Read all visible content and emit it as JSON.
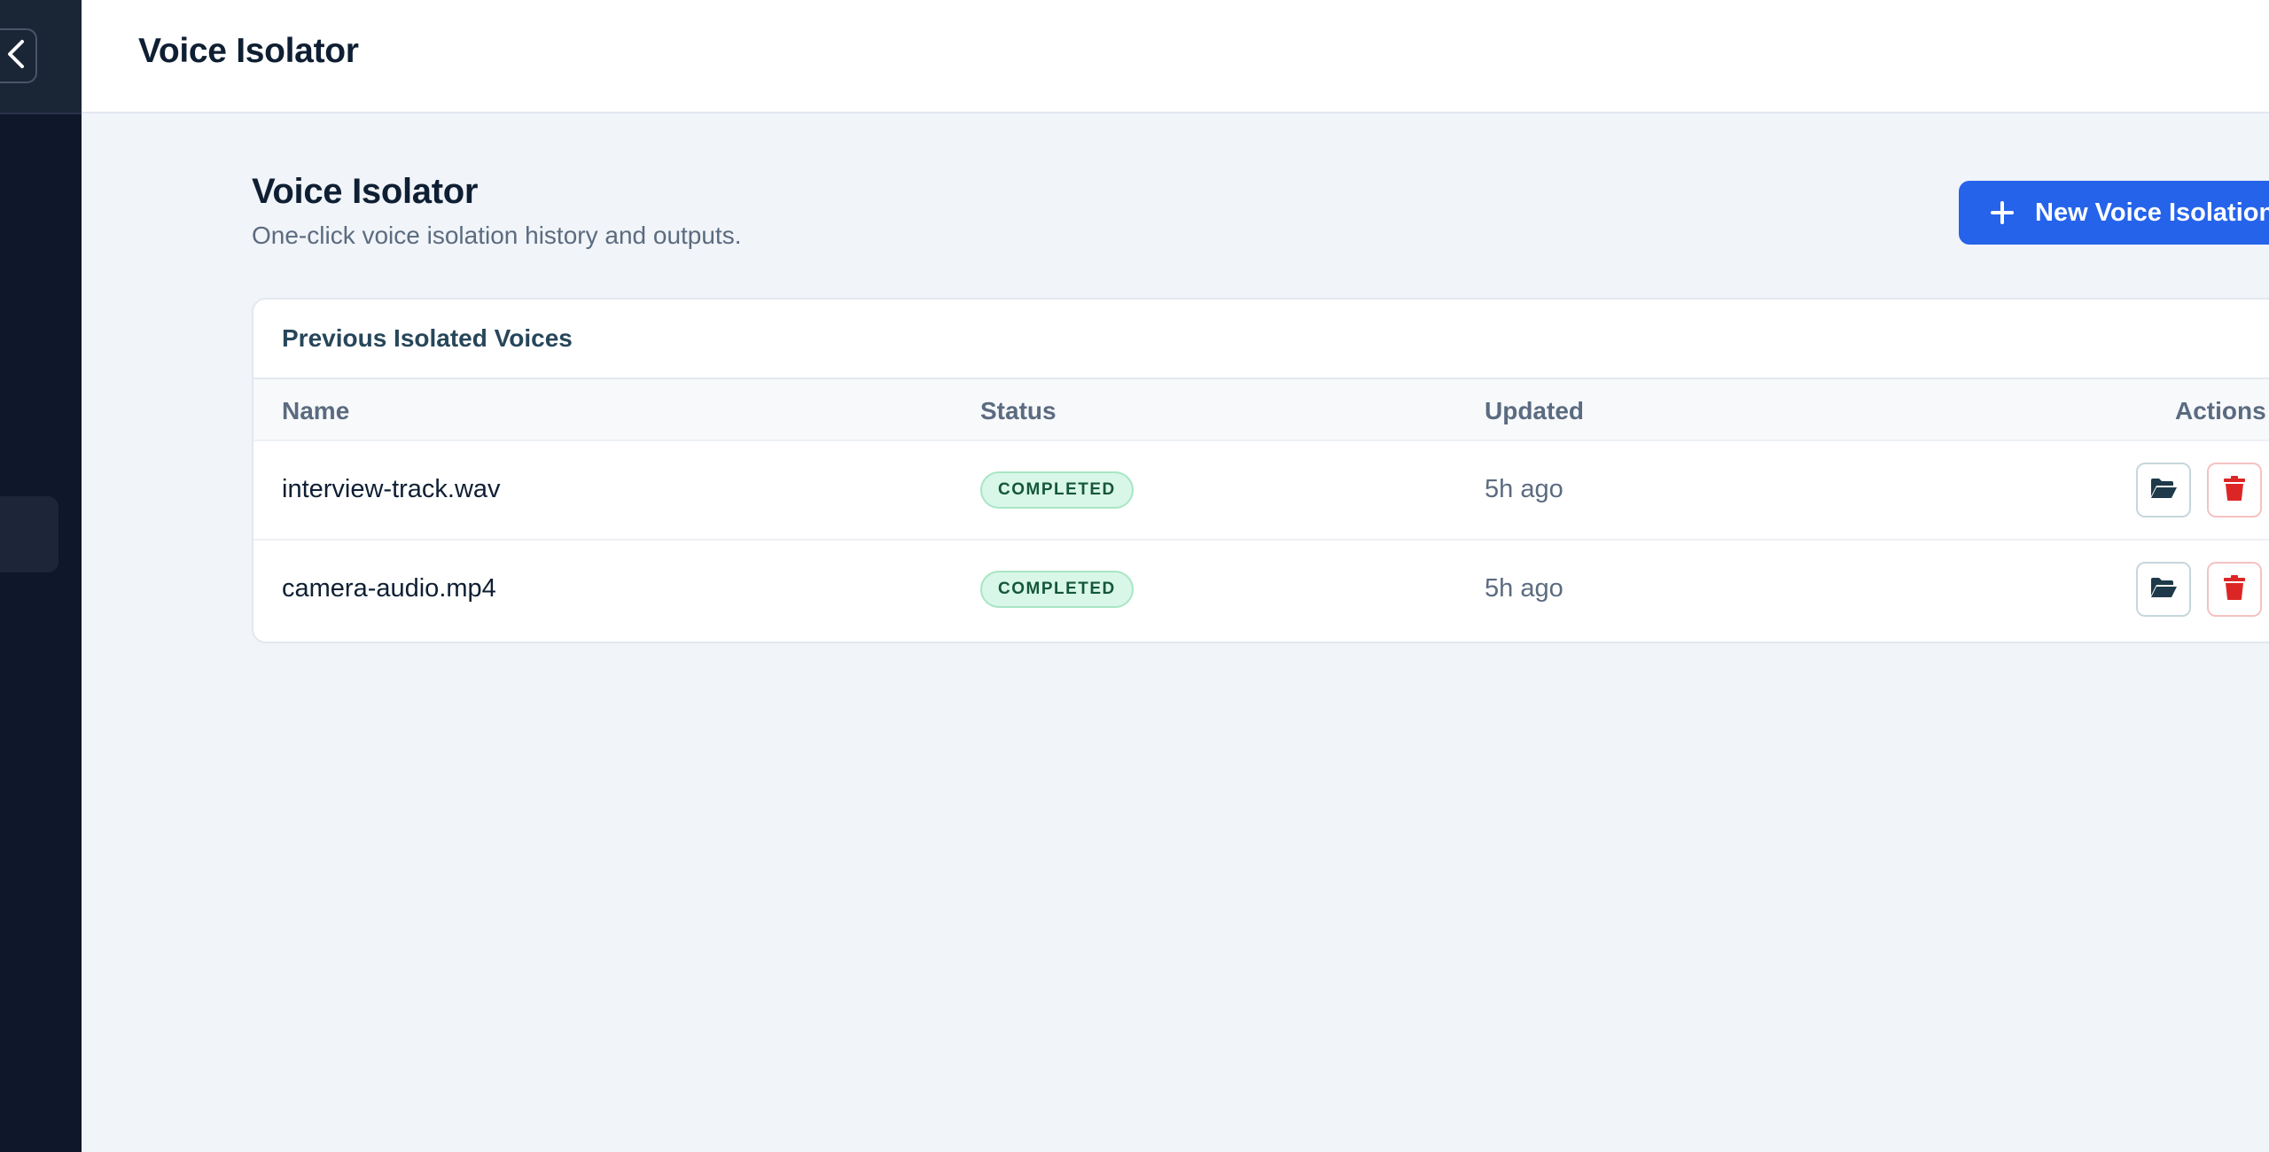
{
  "sidebar": {
    "collapse_icon": "chevron-left-icon"
  },
  "header": {
    "title": "Voice Isolator"
  },
  "page": {
    "title": "Voice Isolator",
    "subtitle": "One-click voice isolation history and outputs.",
    "new_button_label": "New Voice Isolation",
    "new_button_icon": "plus-icon"
  },
  "card": {
    "title": "Previous Isolated Voices",
    "columns": {
      "name": "Name",
      "status": "Status",
      "updated": "Updated",
      "actions": "Actions"
    },
    "rows": [
      {
        "name": "interview-track.wav",
        "status": "COMPLETED",
        "updated": "5h ago"
      },
      {
        "name": "camera-audio.mp4",
        "status": "COMPLETED",
        "updated": "5h ago"
      }
    ]
  },
  "colors": {
    "rail": "#0f172a",
    "accent": "#2563eb",
    "status_completed_bg": "#d9f7e8",
    "status_completed_text": "#14573a",
    "delete": "#dc2626",
    "open": "#1e3a4a"
  }
}
